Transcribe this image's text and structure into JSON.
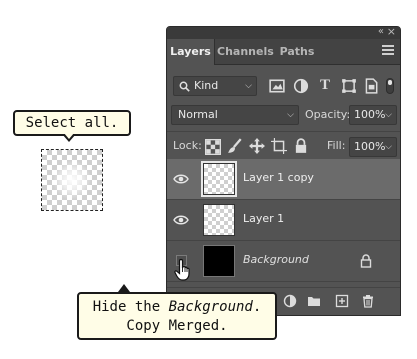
{
  "callouts": {
    "top": "Select all.",
    "bottom_line1_prefix": "Hide the ",
    "bottom_line1_italic": "Background",
    "bottom_line1_suffix": ".",
    "bottom_line2": "Copy Merged."
  },
  "panel": {
    "tabs": [
      {
        "label": "Layers",
        "active": true
      },
      {
        "label": "Channels",
        "active": false
      },
      {
        "label": "Paths",
        "active": false
      }
    ],
    "filter": {
      "kind_label": "Kind",
      "filter_icons": [
        "image-filter-icon",
        "adjustment-filter-icon",
        "type-filter-icon",
        "shape-filter-icon",
        "smart-object-filter-icon"
      ]
    },
    "blend": {
      "mode": "Normal",
      "opacity_label": "Opacity:",
      "opacity_value": "100%"
    },
    "lock": {
      "label": "Lock:",
      "fill_label": "Fill:",
      "fill_value": "100%"
    },
    "layers": [
      {
        "name": "Layer 1 copy",
        "visible": true,
        "selected": true,
        "italic": false,
        "thumb": "transparent"
      },
      {
        "name": "Layer 1",
        "visible": true,
        "selected": false,
        "italic": false,
        "thumb": "transparent"
      },
      {
        "name": "Background",
        "visible": false,
        "selected": false,
        "italic": true,
        "thumb": "black",
        "locked": true
      }
    ]
  },
  "colors": {
    "panel_bg": "#535353",
    "selected_row": "#6b6b6b",
    "callout_bg": "#fffde7"
  }
}
